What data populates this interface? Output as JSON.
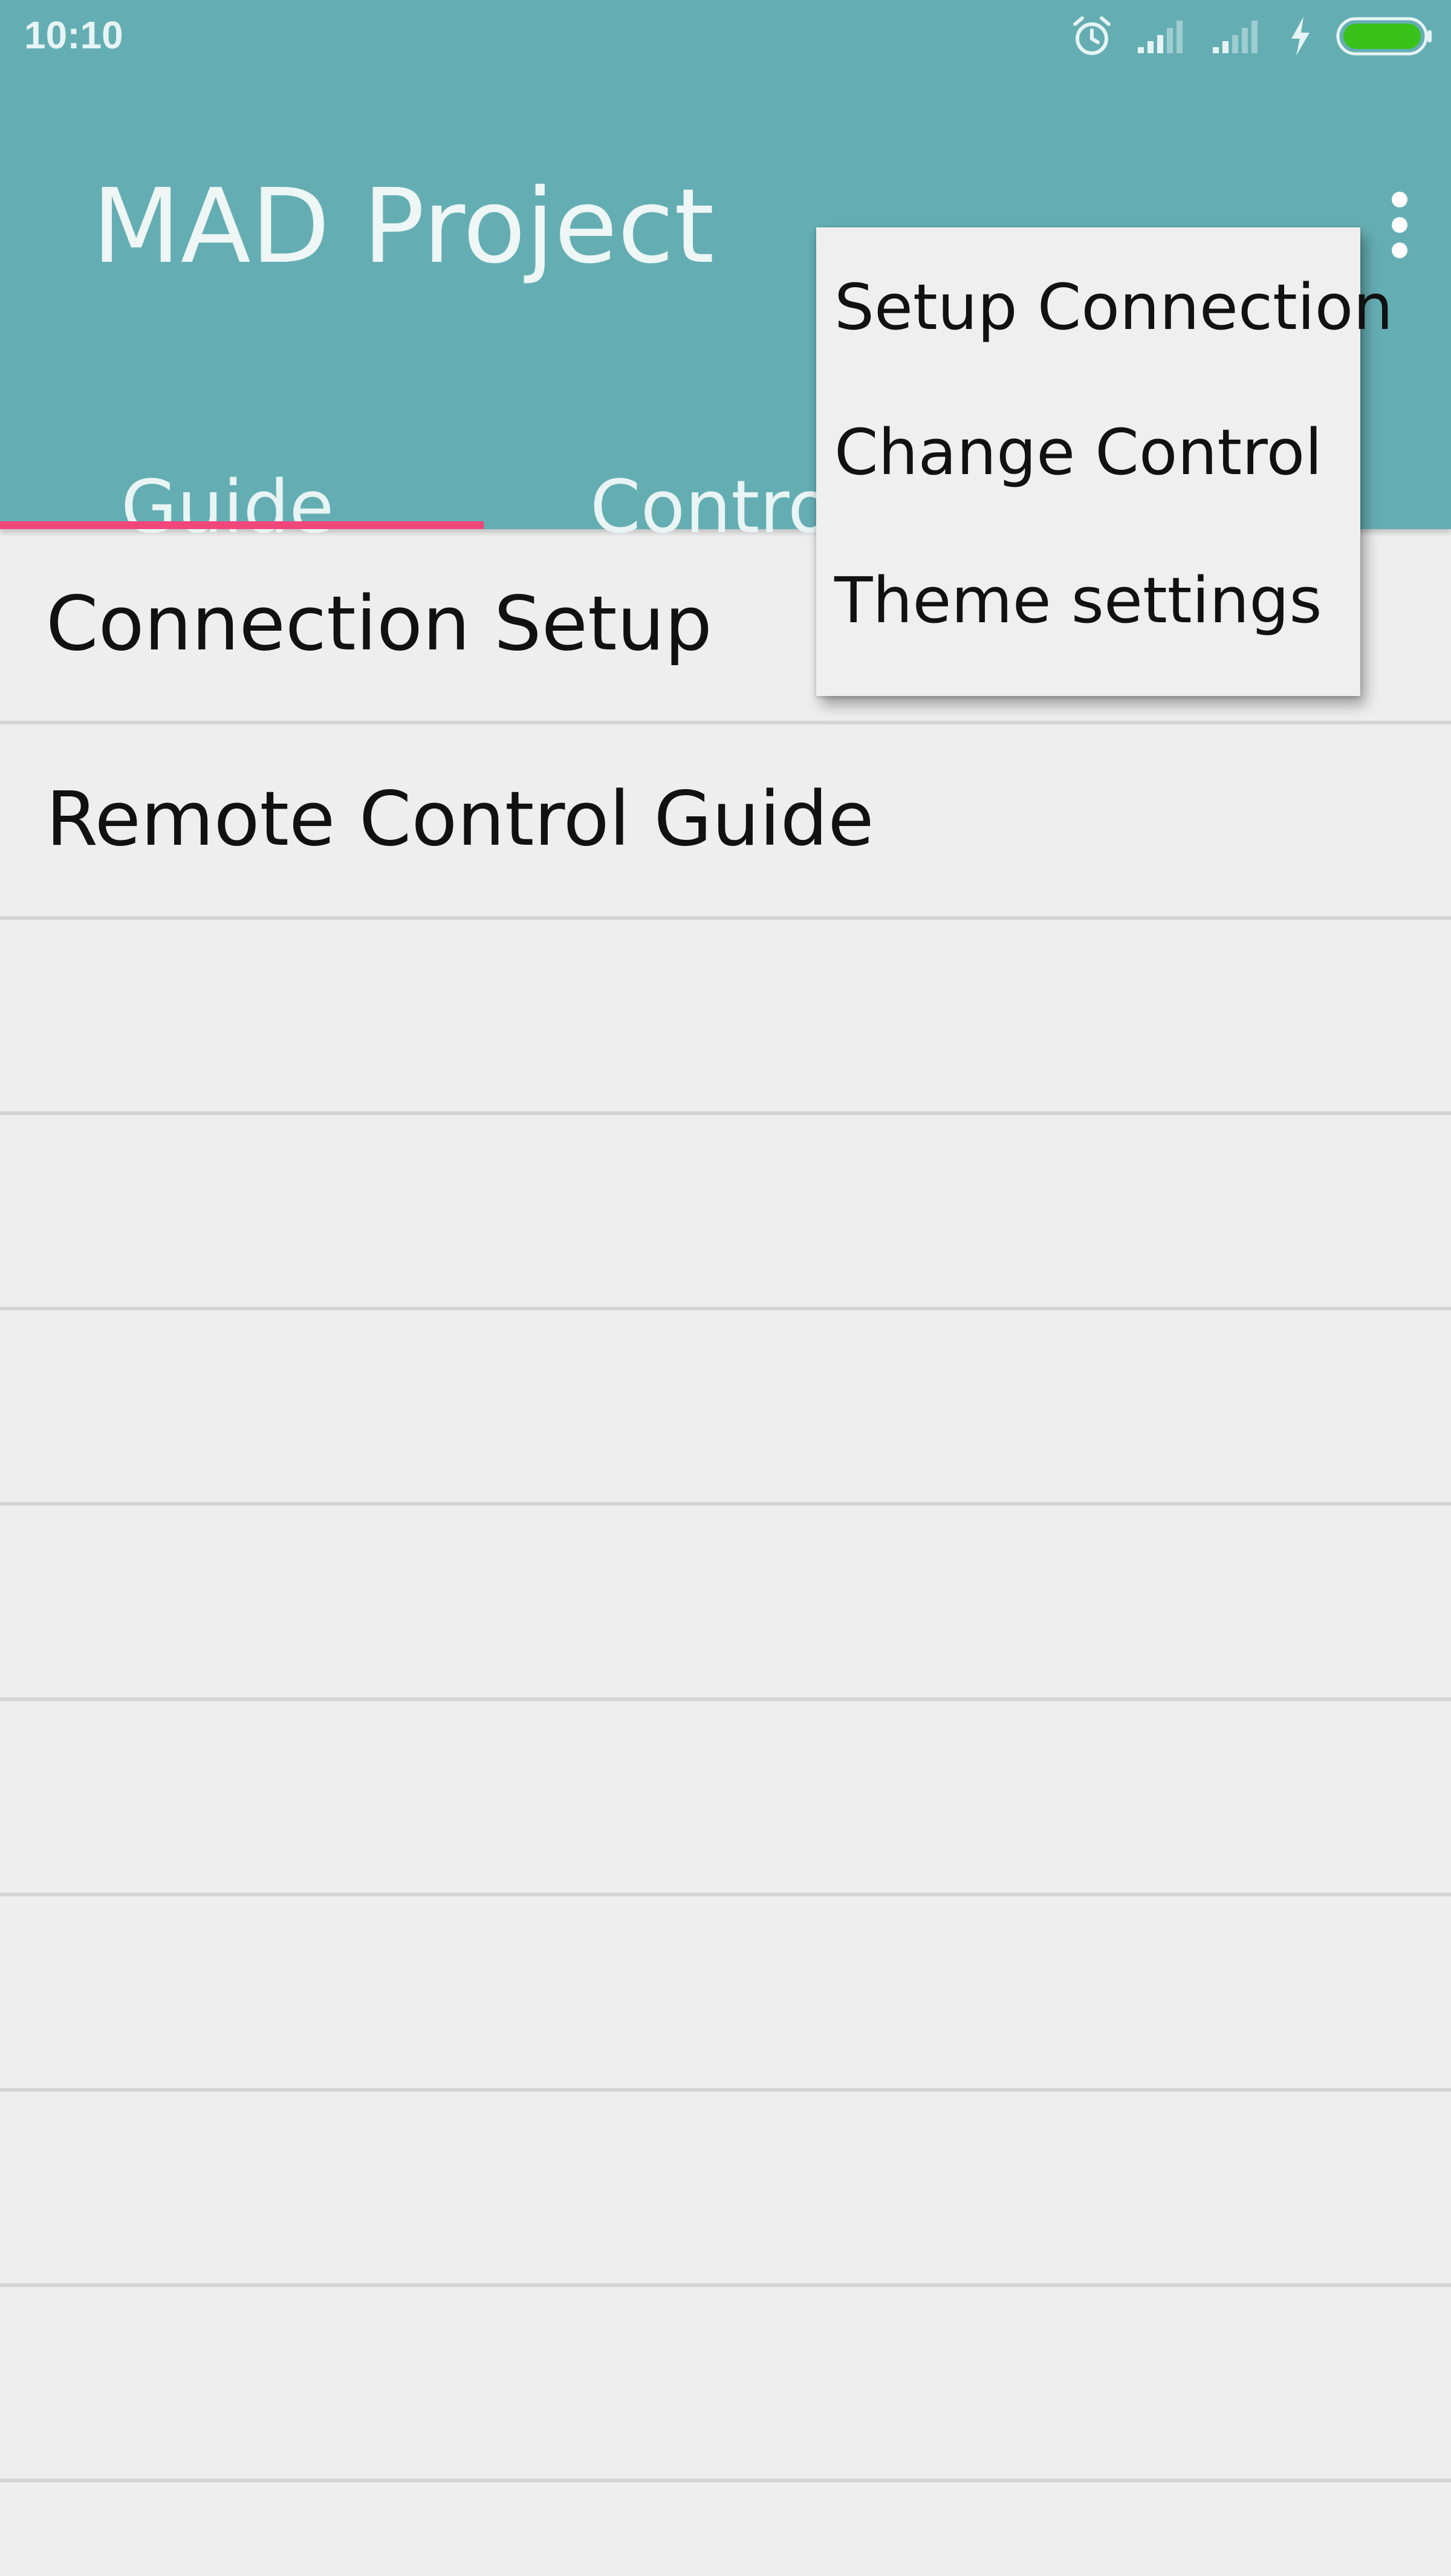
{
  "status_bar": {
    "time": "10:10",
    "icons": [
      "alarm-icon",
      "signal-icon",
      "signal-icon",
      "charging-icon",
      "battery-icon"
    ],
    "battery_color": "#38c21a"
  },
  "app_bar": {
    "title": "MAD Project",
    "background_color": "#64aeb3",
    "tabs": [
      {
        "label": "Guide",
        "selected": true
      },
      {
        "label": "Control",
        "selected": false
      }
    ],
    "indicator_color": "#f0467a"
  },
  "list": {
    "items": [
      {
        "label": "Connection Setup"
      },
      {
        "label": "Remote Control Guide"
      }
    ]
  },
  "overflow_menu": {
    "items": [
      {
        "label": "Setup Connection"
      },
      {
        "label": "Change Control"
      },
      {
        "label": "Theme settings"
      }
    ]
  }
}
